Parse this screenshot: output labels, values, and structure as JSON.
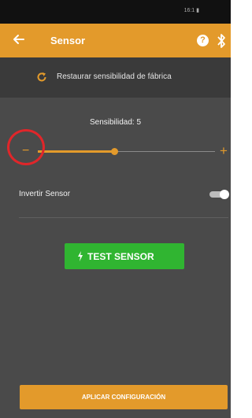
{
  "status_bar": {
    "text": "16:1 ▮"
  },
  "app_bar": {
    "title": "Sensor",
    "help_glyph": "?",
    "back_icon": "arrow-left-icon",
    "bluetooth_icon": "bluetooth-icon"
  },
  "restore": {
    "label": "Restaurar sensibilidad de fábrica",
    "icon": "refresh-icon"
  },
  "sensitivity": {
    "label": "Sensibilidad: 5",
    "minus": "−",
    "plus": "+",
    "value_fraction": 0.43
  },
  "invert": {
    "label": "Invertir Sensor",
    "enabled": true
  },
  "test_button": {
    "label": "TEST SENSOR",
    "icon": "bolt-icon"
  },
  "apply_button": {
    "label": "APLICAR CONFIGURACIÓN"
  },
  "colors": {
    "accent": "#e39a2b",
    "test_green": "#30b531",
    "highlight_red": "#e0262a",
    "background": "#4a4a4a"
  }
}
